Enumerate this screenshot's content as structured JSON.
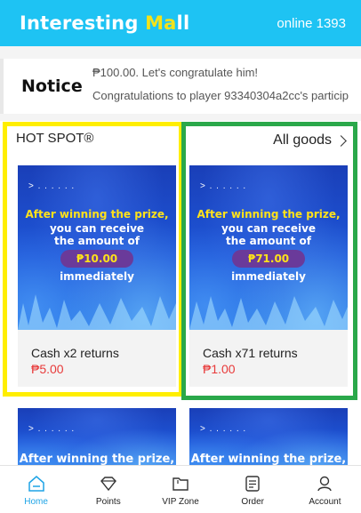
{
  "header": {
    "logo_part1": "Interesting ",
    "logo_highlight": "Ma",
    "logo_part2": "ll",
    "online": "online 1393"
  },
  "notice": {
    "label": "Notice",
    "line1": "₱100.00. Let's congratulate him!",
    "line2": "Congratulations to player 93340304a2cc's particip"
  },
  "section": {
    "title": "HOT SPOT®",
    "all_goods": "All goods"
  },
  "banner": {
    "dots": "> . . . . . .",
    "line1": "After winning the prize,",
    "line2": "you can receive",
    "line3": "the amount of",
    "line4": "immediately"
  },
  "products": [
    {
      "amount": "₱10.00",
      "name": "Cash x2 returns",
      "price": "₱5.00"
    },
    {
      "amount": "₱71.00",
      "name": "Cash x71 returns",
      "price": "₱1.00"
    },
    {
      "amount": "",
      "name": "",
      "price": ""
    },
    {
      "amount": "",
      "name": "",
      "price": ""
    }
  ],
  "nav": {
    "items": [
      {
        "label": "Home",
        "icon": "home-icon",
        "active": true
      },
      {
        "label": "Points",
        "icon": "diamond-icon",
        "active": false
      },
      {
        "label": "VIP Zone",
        "icon": "folder-icon",
        "active": false
      },
      {
        "label": "Order",
        "icon": "order-icon",
        "active": false
      },
      {
        "label": "Account",
        "icon": "user-icon",
        "active": false
      }
    ]
  },
  "colors": {
    "header_bg": "#1ec3f3",
    "accent": "#1ea4e6",
    "price": "#e83a3a",
    "highlight_yellow": "#ffee00",
    "highlight_green": "#2aa84a"
  }
}
